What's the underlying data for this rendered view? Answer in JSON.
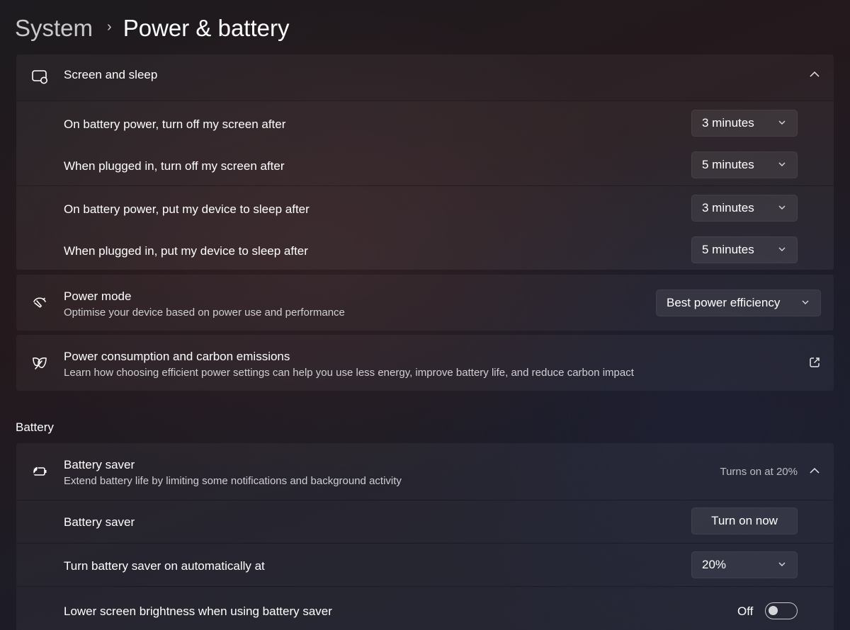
{
  "breadcrumb": {
    "parent": "System",
    "separator": "›",
    "current": "Power & battery"
  },
  "screen_sleep": {
    "icon": "screen-sleep-icon",
    "title": "Screen and sleep",
    "expanded": true,
    "rows": [
      {
        "label": "On battery power, turn off my screen after",
        "value": "3 minutes"
      },
      {
        "label": "When plugged in, turn off my screen after",
        "value": "5 minutes"
      },
      {
        "label": "On battery power, put my device to sleep after",
        "value": "3 minutes"
      },
      {
        "label": "When plugged in, put my device to sleep after",
        "value": "5 minutes"
      }
    ]
  },
  "power_mode": {
    "icon": "power-mode-gauge-icon",
    "title": "Power mode",
    "subtitle": "Optimise your device based on power use and performance",
    "value": "Best power efficiency"
  },
  "power_consumption": {
    "icon": "leaf-icon",
    "title": "Power consumption and carbon emissions",
    "subtitle": "Learn how choosing efficient power settings can help you use less energy, improve battery life, and reduce carbon impact",
    "action_icon": "open-external-icon"
  },
  "battery_section": {
    "label": "Battery",
    "battery_saver": {
      "icon": "battery-saver-icon",
      "title": "Battery saver",
      "subtitle": "Extend battery life by limiting some notifications and background activity",
      "status": "Turns on at 20%",
      "expanded": true
    },
    "rows": {
      "saver": {
        "label": "Battery saver",
        "button": "Turn on now"
      },
      "auto": {
        "label": "Turn battery saver on automatically at",
        "value": "20%"
      },
      "brightness": {
        "label": "Lower screen brightness when using battery saver",
        "state_label": "Off",
        "on": false
      }
    }
  }
}
